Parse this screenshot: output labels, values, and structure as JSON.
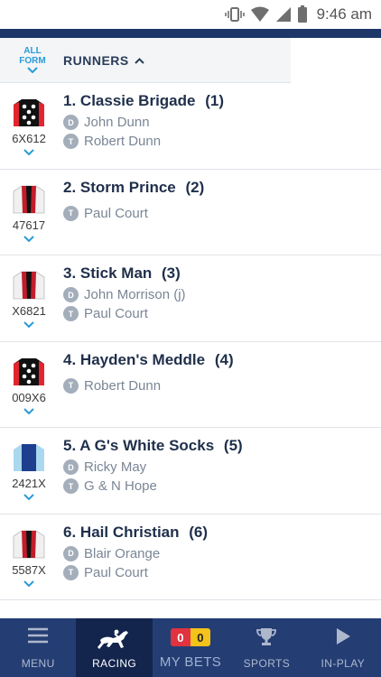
{
  "status": {
    "time": "9:46 am"
  },
  "header": {
    "all_form": [
      "ALL",
      "FORM"
    ],
    "runners_label": "RUNNERS"
  },
  "runners": [
    {
      "number": "1.",
      "name": "Classie Brigade",
      "draw": "(1)",
      "form": "6X612",
      "silk": "red-black-spots",
      "driver": "John Dunn",
      "trainer": "Robert Dunn"
    },
    {
      "number": "2.",
      "name": "Storm Prince",
      "draw": "(2)",
      "form": "47617",
      "silk": "white-red-black",
      "driver": "",
      "trainer": "Paul Court"
    },
    {
      "number": "3.",
      "name": "Stick Man",
      "draw": "(3)",
      "form": "X6821",
      "silk": "white-red-black",
      "driver": "John Morrison (j)",
      "trainer": "Paul Court"
    },
    {
      "number": "4.",
      "name": "Hayden's Meddle",
      "draw": "(4)",
      "form": "009X6",
      "silk": "red-black-spots",
      "driver": "",
      "trainer": "Robert Dunn"
    },
    {
      "number": "5.",
      "name": "A G's White Socks",
      "draw": "(5)",
      "form": "2421X",
      "silk": "lightblue-navy",
      "driver": "Ricky May",
      "trainer": "G & N Hope"
    },
    {
      "number": "6.",
      "name": "Hail Christian",
      "draw": "(6)",
      "form": "5587X",
      "silk": "white-red-black",
      "driver": "Blair Orange",
      "trainer": "Paul Court"
    }
  ],
  "badges": {
    "driver": "D",
    "trainer": "T"
  },
  "nav": {
    "menu": "MENU",
    "racing": "RACING",
    "my_bets": "MY BETS",
    "bets_red": "0",
    "bets_yellow": "0",
    "sports": "SPORTS",
    "in_play": "IN-PLAY"
  },
  "colors": {
    "navy": "#243e74",
    "accent": "#2a9bd8",
    "active_nav": "#13254d"
  }
}
